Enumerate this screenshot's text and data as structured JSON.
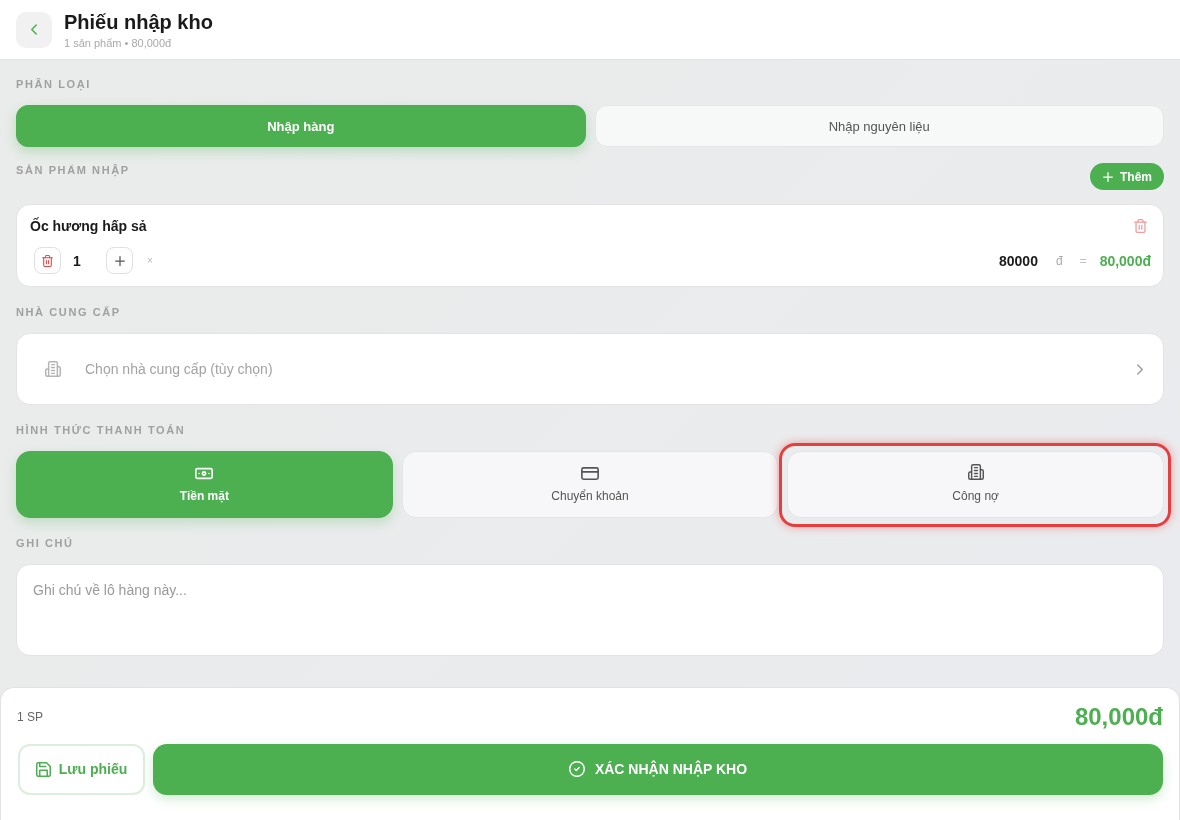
{
  "header": {
    "title": "Phiếu nhập kho",
    "subtitle": "1 sản phẩm • 80,000đ"
  },
  "category": {
    "label": "PHÂN LOẠI",
    "options": [
      {
        "label": "Nhập hàng",
        "selected": true
      },
      {
        "label": "Nhập nguyên liệu",
        "selected": false
      }
    ]
  },
  "products": {
    "label": "SẢN PHẨM NHẬP",
    "add_button": "Thêm",
    "items": [
      {
        "name": "Ốc hương hấp sả",
        "quantity": "1",
        "times": "×",
        "unit_price": "80000",
        "currency": "đ",
        "equals": "=",
        "total": "80,000đ"
      }
    ]
  },
  "supplier": {
    "label": "NHÀ CUNG CẤP",
    "placeholder": "Chọn nhà cung cấp (tùy chọn)"
  },
  "payment": {
    "label": "HÌNH THỨC THANH TOÁN",
    "options": [
      {
        "kind": "cash",
        "label": "Tiền mặt",
        "selected": true,
        "highlighted": false
      },
      {
        "kind": "transfer",
        "label": "Chuyển khoản",
        "selected": false,
        "highlighted": false
      },
      {
        "kind": "debt",
        "label": "Công nợ",
        "selected": false,
        "highlighted": true
      }
    ]
  },
  "note": {
    "label": "GHI CHÚ",
    "placeholder": "Ghi chú về lô hàng này..."
  },
  "footer": {
    "count": "1 SP",
    "total": "80,000đ",
    "save_button": "Lưu phiếu",
    "confirm_button": "XÁC NHẬN NHẬP KHO"
  }
}
